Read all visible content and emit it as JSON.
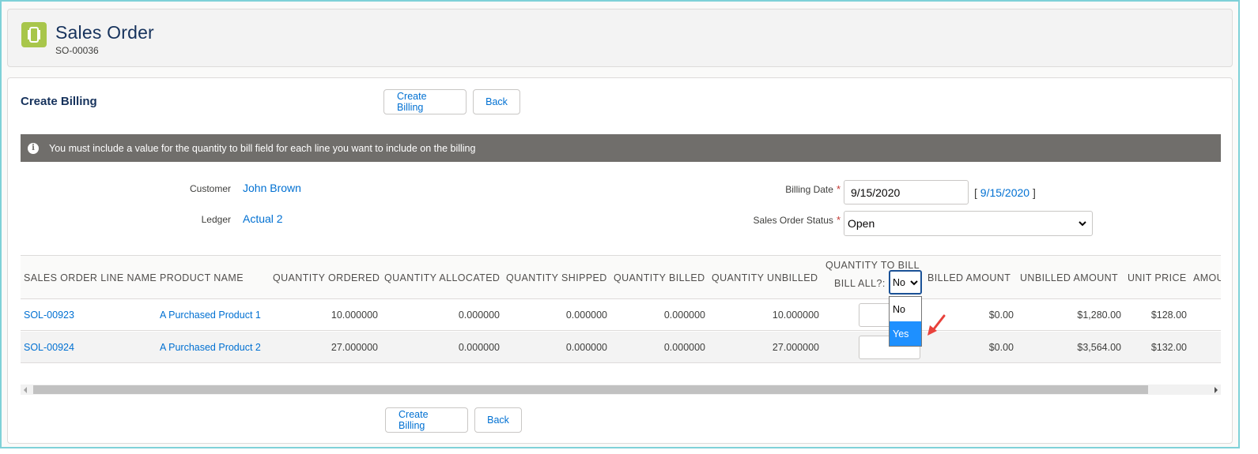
{
  "header": {
    "title": "Sales Order",
    "subtitle": "SO-00036",
    "icon": "order-icon"
  },
  "section": {
    "title": "Create Billing",
    "create_billing_label": "Create Billing",
    "back_label": "Back"
  },
  "banner": {
    "icon": "info-icon",
    "text": "You must include a value for the quantity to bill field for each line you want to include on the billing"
  },
  "fields": {
    "customer_label": "Customer",
    "customer_value": "John Brown",
    "ledger_label": "Ledger",
    "ledger_value": "Actual 2",
    "billing_date_label": "Billing Date",
    "billing_date_value": "9/15/2020",
    "billing_date_today_open": "[",
    "billing_date_today": "9/15/2020",
    "billing_date_today_close": "]",
    "status_label": "Sales Order Status",
    "status_value": "Open",
    "required_marker": "*"
  },
  "table": {
    "headers": {
      "line_name": "SALES ORDER LINE NAME",
      "product_name": "PRODUCT NAME",
      "qty_ordered": "QUANTITY ORDERED",
      "qty_allocated": "QUANTITY ALLOCATED",
      "qty_shipped": "QUANTITY SHIPPED",
      "qty_billed": "QUANTITY BILLED",
      "qty_unbilled": "QUANTITY UNBILLED",
      "qty_to_bill": "QUANTITY TO BILL",
      "bill_all": "BILL ALL?:",
      "billed_amount": "BILLED AMOUNT",
      "unbilled_amount": "UNBILLED AMOUNT",
      "unit_price": "UNIT PRICE",
      "amount": "AMOU"
    },
    "bill_all_select_value": "No",
    "bill_all_options": [
      "No",
      "Yes"
    ],
    "rows": [
      {
        "line_name": "SOL-00923",
        "product_name": "A Purchased Product 1",
        "qty_ordered": "10.000000",
        "qty_allocated": "0.000000",
        "qty_shipped": "0.000000",
        "qty_billed": "0.000000",
        "qty_unbilled": "10.000000",
        "billed_amount": "$0.00",
        "unbilled_amount": "$1,280.00",
        "unit_price": "$128.00"
      },
      {
        "line_name": "SOL-00924",
        "product_name": "A Purchased Product 2",
        "qty_ordered": "27.000000",
        "qty_allocated": "0.000000",
        "qty_shipped": "0.000000",
        "qty_billed": "0.000000",
        "qty_unbilled": "27.000000",
        "billed_amount": "$0.00",
        "unbilled_amount": "$3,564.00",
        "unit_price": "$132.00"
      }
    ]
  },
  "footer": {
    "create_billing_label": "Create Billing",
    "back_label": "Back"
  },
  "colors": {
    "brand_link": "#0070d2",
    "title": "#16325c",
    "banner_bg": "#706e6b",
    "icon_bg": "#a8c64b",
    "dropdown_selected": "#1e90ff",
    "annotation_arrow": "#e8413b"
  }
}
